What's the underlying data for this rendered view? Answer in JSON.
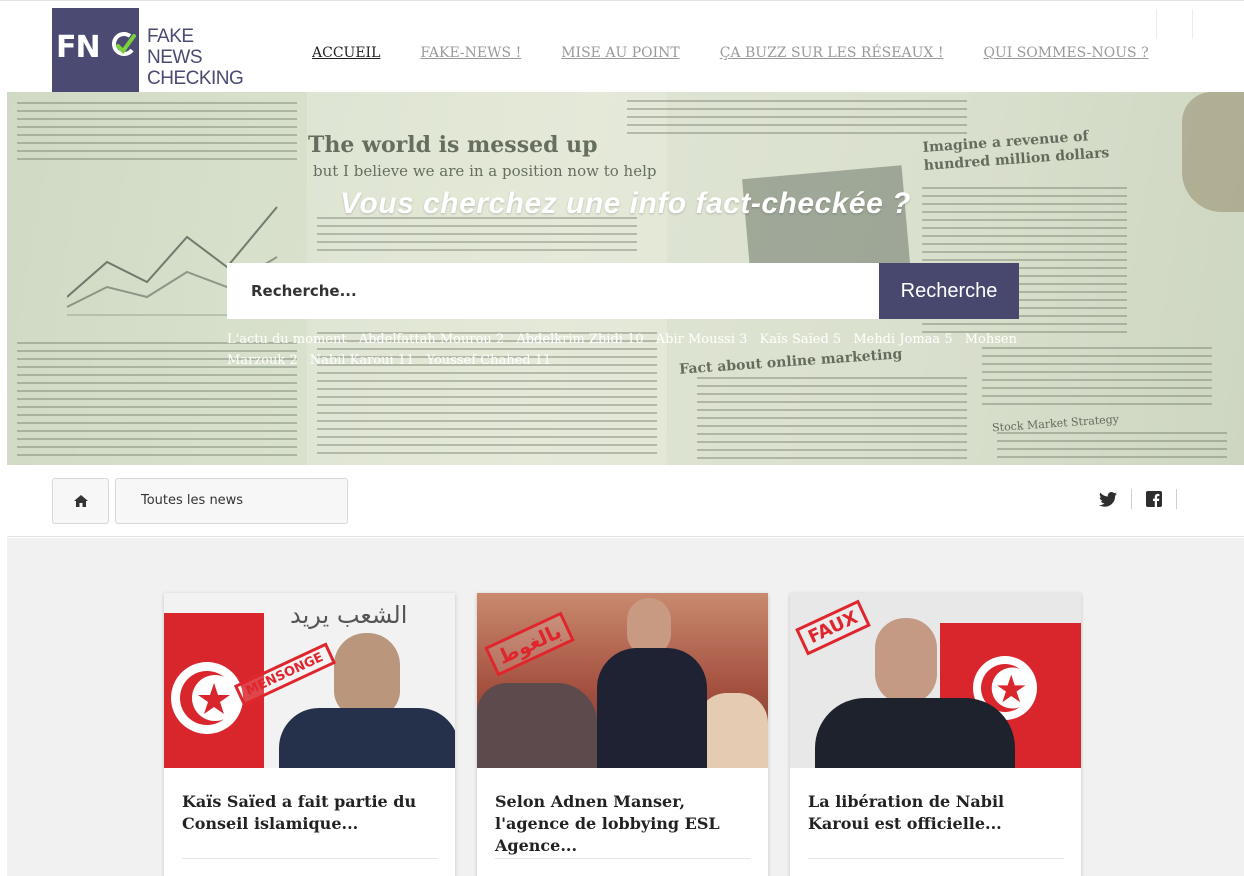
{
  "header": {
    "logo_mark": "FN",
    "logo_line1": "FAKE NEWS",
    "logo_line2": "CHECKING",
    "nav": [
      {
        "label": "ACCUEIL"
      },
      {
        "label": "FAKE-NEWS !"
      },
      {
        "label": "MISE AU POINT"
      },
      {
        "label": "ÇA BUZZ SUR LES RÉSEAUX !"
      },
      {
        "label": "QUI SOMMES-NOUS ?"
      }
    ]
  },
  "hero": {
    "title": "Vous cherchez une info fact-checkée ?",
    "search_placeholder": "Recherche...",
    "search_button": "Recherche",
    "tags": [
      "L'actu du moment",
      "Abdelfattah Mourou 2",
      "Abdelkrim Zbidi 10",
      "Abir Moussi 3",
      "Kaïs Saïed 5",
      "Mehdi Jomaa 5",
      "Mohsen Marzouk 2",
      "Nabil Karoui 11",
      "Youssef Chahed 11"
    ],
    "background_text": {
      "headline": "The world is messed up",
      "subheadline": "but I believe we are in a position now to help",
      "right_headline": "Imagine a revenue of hundred million dollars",
      "bottom_headline": "Fact about online marketing",
      "side_heading": "Stock Market Strategy"
    }
  },
  "breadcrumb": {
    "home_icon": "home-icon",
    "all_news": "Toutes les news"
  },
  "social": {
    "twitter_icon": "twitter-icon",
    "facebook_icon": "facebook-icon"
  },
  "cards": [
    {
      "title": "Kaïs Saïed a fait partie du Conseil islamique...",
      "stamp": "MENSONGE",
      "banner": "الشعب يريد"
    },
    {
      "title": "Selon Adnen Manser, l'agence de lobbying ESL Agence...",
      "stamp": "بالغوط"
    },
    {
      "title": "La libération de Nabil Karoui est officielle...",
      "stamp": "FAUX"
    }
  ],
  "colors": {
    "brand": "#4a4a72",
    "stamp_red": "#e0262d",
    "hero_overlay": "#c8d4bb"
  }
}
